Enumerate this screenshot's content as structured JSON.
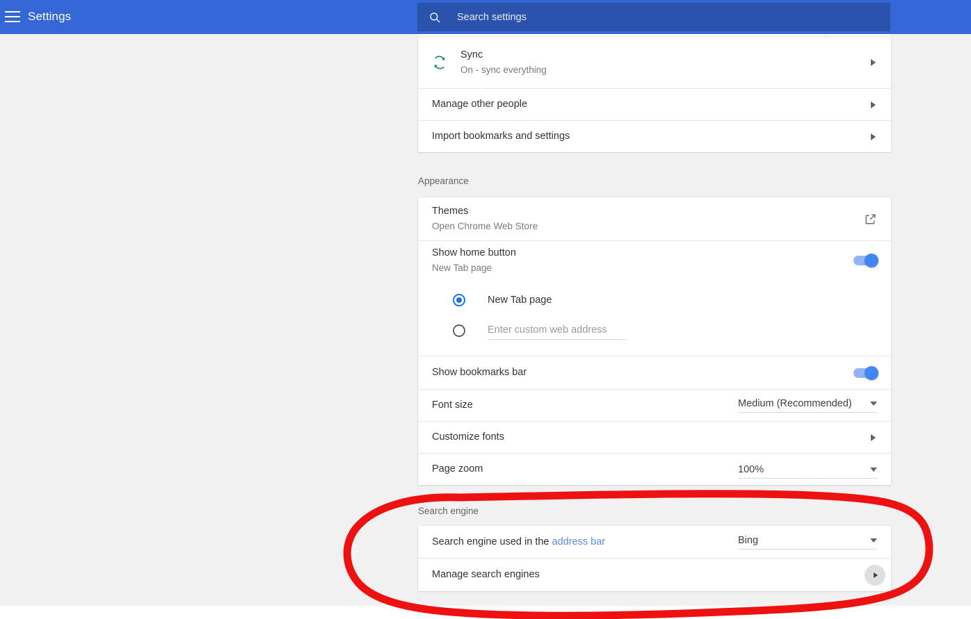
{
  "header": {
    "title": "Settings",
    "menu_icon": "hamburger-icon",
    "search": {
      "icon": "search-icon",
      "placeholder": "Search settings",
      "value": ""
    },
    "accent_color": "#3367d6",
    "search_field_color": "#2a53ad"
  },
  "people_section": {
    "avatar_row": {
      "name": "",
      "avatar": "user-avatar"
    },
    "rows": [
      {
        "title": "Sync",
        "subtitle": "On - sync everything",
        "icon": "sync-icon",
        "icon_color": "#1e8e4e",
        "control": "chevron-right"
      },
      {
        "title": "Manage other people",
        "subtitle": "",
        "control": "chevron-right"
      },
      {
        "title": "Import bookmarks and settings",
        "subtitle": "",
        "control": "chevron-right"
      }
    ]
  },
  "appearance": {
    "label": "Appearance",
    "themes": {
      "title": "Themes",
      "subtitle": "Open Chrome Web Store",
      "control": "open-in-new-icon"
    },
    "home_button": {
      "title": "Show home button",
      "subtitle": "New Tab page",
      "toggle_on": true,
      "options": [
        {
          "label": "New Tab page",
          "selected": true
        },
        {
          "label": "",
          "placeholder": "Enter custom web address",
          "selected": false
        }
      ]
    },
    "bookmarks_bar": {
      "title": "Show bookmarks bar",
      "toggle_on": true
    },
    "font_size": {
      "title": "Font size",
      "value": "Medium (Recommended)"
    },
    "customize_fonts": {
      "title": "Customize fonts",
      "control": "chevron-right"
    },
    "page_zoom": {
      "title": "Page zoom",
      "value": "100%"
    }
  },
  "search_engine": {
    "label": "Search engine",
    "address_bar_row": {
      "title_prefix": "Search engine used in the ",
      "link_text": "address bar",
      "value": "Bing"
    },
    "manage_row": {
      "title": "Manage search engines",
      "control": "chevron-right-circle"
    }
  },
  "annotation": {
    "shape": "hand-drawn-ellipse",
    "color": "#ee1111",
    "stroke_width": 11
  }
}
